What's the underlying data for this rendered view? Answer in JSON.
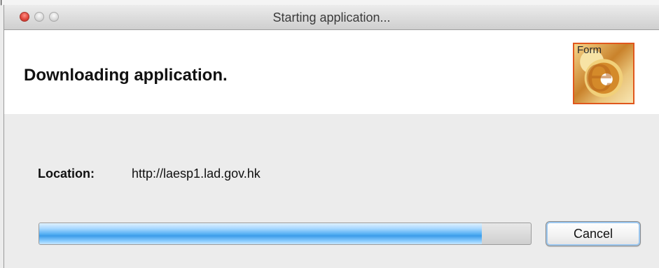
{
  "window": {
    "title": "Starting application..."
  },
  "header": {
    "heading": "Downloading application.",
    "icon_label": "Form",
    "icon_letter": "e"
  },
  "location": {
    "label": "Location:",
    "value": "http://laesp1.lad.gov.hk"
  },
  "progress": {
    "fraction": 0.9
  },
  "actions": {
    "cancel_label": "Cancel"
  },
  "colors": {
    "progress_blue": "#3c9ce9",
    "icon_border": "#e0571d",
    "close_red": "#e0483e"
  },
  "icons": {
    "close": "close-icon",
    "minimize": "minimize-icon",
    "zoom": "zoom-icon",
    "app": "app-icon"
  }
}
